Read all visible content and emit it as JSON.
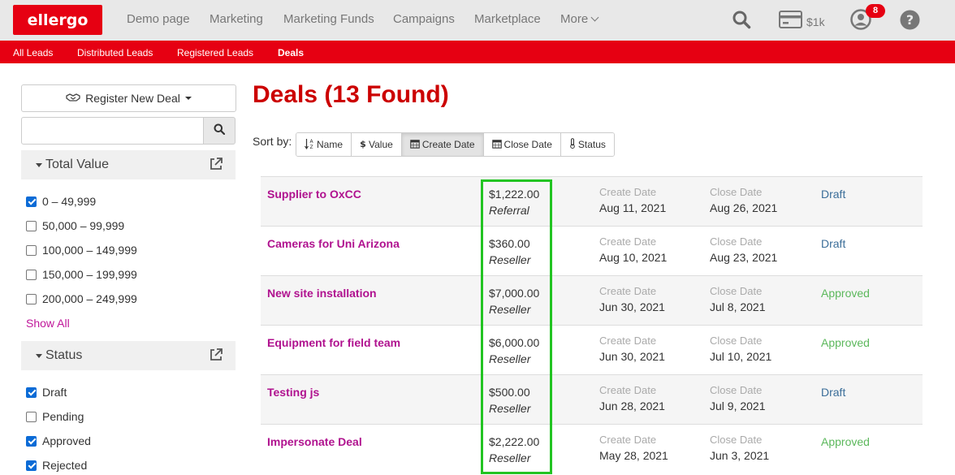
{
  "brand": {
    "logo_text": "ellergo",
    "primary_color": "#e60012",
    "accent_color": "#c0179a"
  },
  "nav": {
    "items": [
      "Demo page",
      "Marketing",
      "Marketing Funds",
      "Campaigns",
      "Marketplace"
    ],
    "more_label": "More",
    "credit_label": "$1k",
    "notification_count": "8"
  },
  "subnav": {
    "items": [
      "All Leads",
      "Distributed Leads",
      "Registered Leads",
      "Deals"
    ],
    "active": "Deals"
  },
  "sidebar": {
    "register_label": "Register New Deal",
    "search_placeholder": "",
    "total_value": {
      "title": "Total Value",
      "options": [
        {
          "label": "0 – 49,999",
          "checked": true
        },
        {
          "label": "50,000 – 99,999",
          "checked": false
        },
        {
          "label": "100,000 – 149,999",
          "checked": false
        },
        {
          "label": "150,000 – 199,999",
          "checked": false
        },
        {
          "label": "200,000 – 249,999",
          "checked": false
        }
      ],
      "show_all_label": "Show All"
    },
    "status": {
      "title": "Status",
      "options": [
        {
          "label": "Draft",
          "checked": true
        },
        {
          "label": "Pending",
          "checked": false
        },
        {
          "label": "Approved",
          "checked": true
        },
        {
          "label": "Rejected",
          "checked": true
        }
      ]
    }
  },
  "main": {
    "title": "Deals (13 Found)",
    "sort_label": "Sort by:",
    "sort_buttons": [
      {
        "label": "Name",
        "icon": "sort-alpha-icon",
        "active": false
      },
      {
        "label": "Value",
        "icon": "dollar-icon",
        "active": false
      },
      {
        "label": "Create Date",
        "icon": "calendar-icon",
        "active": true
      },
      {
        "label": "Close Date",
        "icon": "calendar-icon",
        "active": false
      },
      {
        "label": "Status",
        "icon": "thermometer-icon",
        "active": false
      }
    ],
    "create_date_label": "Create Date",
    "close_date_label": "Close Date",
    "deals": [
      {
        "name": "Supplier to OxCC",
        "value": "$1,222.00",
        "type": "Referral",
        "create_date": "Aug 11, 2021",
        "close_date": "Aug 26, 2021",
        "status": "Draft"
      },
      {
        "name": "Cameras for Uni Arizona",
        "value": "$360.00",
        "type": "Reseller",
        "create_date": "Aug 10, 2021",
        "close_date": "Aug 23, 2021",
        "status": "Draft"
      },
      {
        "name": "New site installation",
        "value": "$7,000.00",
        "type": "Reseller",
        "create_date": "Jun 30, 2021",
        "close_date": "Jul 8, 2021",
        "status": "Approved"
      },
      {
        "name": "Equipment for field team",
        "value": "$6,000.00",
        "type": "Reseller",
        "create_date": "Jun 30, 2021",
        "close_date": "Jul 10, 2021",
        "status": "Approved"
      },
      {
        "name": "Testing js",
        "value": "$500.00",
        "type": "Reseller",
        "create_date": "Jun 28, 2021",
        "close_date": "Jul 9, 2021",
        "status": "Draft"
      },
      {
        "name": "Impersonate Deal",
        "value": "$2,222.00",
        "type": "Reseller",
        "create_date": "May 28, 2021",
        "close_date": "Jun 3, 2021",
        "status": "Approved"
      }
    ]
  }
}
